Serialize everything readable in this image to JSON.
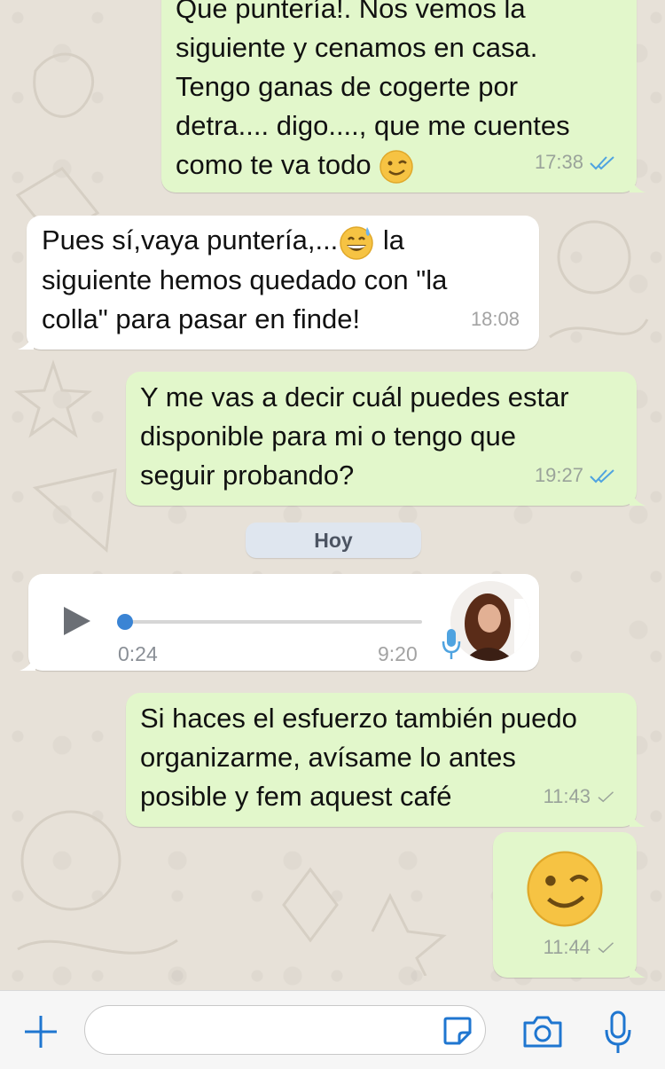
{
  "messages": [
    {
      "id": "m1",
      "direction": "outgoing",
      "text": "Que puntería!. Nos vemos la\nsiguiente y cenamos en casa.\nTengo ganas de cogerte por\ndetra.... digo...., que me cuentes\ncomo te va todo",
      "emoji": "wink",
      "time": "17:38",
      "status": "read"
    },
    {
      "id": "m2",
      "direction": "incoming",
      "text_before": "Pues sí,vaya puntería,...",
      "emoji": "sweat-smile",
      "text_after": " la\nsiguiente hemos quedado con \"la\ncolla\" para pasar en finde!",
      "time": "18:08"
    },
    {
      "id": "m3",
      "direction": "outgoing",
      "text": "Y me vas a decir cuál puedes estar\ndisponible para mi o tengo que\nseguir probando?",
      "time": "19:27",
      "status": "read"
    },
    {
      "id": "m5",
      "direction": "outgoing",
      "text": "Si haces el esfuerzo también puedo\norganizarme, avísame lo antes\nposible y fem aquest café",
      "time": "11:43",
      "status": "sent"
    },
    {
      "id": "m6",
      "direction": "outgoing",
      "emoji": "wink",
      "time": "11:44",
      "status": "sent"
    }
  ],
  "date_separator": "Hoy",
  "voice_message": {
    "direction": "incoming",
    "elapsed": "0:24",
    "time": "9:20",
    "progress": 0.0,
    "icons": [
      "play-icon",
      "microphone-icon",
      "avatar"
    ]
  },
  "input_bar": {
    "placeholder": "",
    "icons": [
      "plus-icon",
      "sticker-icon",
      "camera-icon",
      "microphone-icon"
    ]
  },
  "colors": {
    "outgoing_bubble": "#e2f7cb",
    "incoming_bubble": "#ffffff",
    "read_tick": "#4fa3e0",
    "sent_tick": "#9aa39a",
    "accent": "#1f76d0"
  }
}
